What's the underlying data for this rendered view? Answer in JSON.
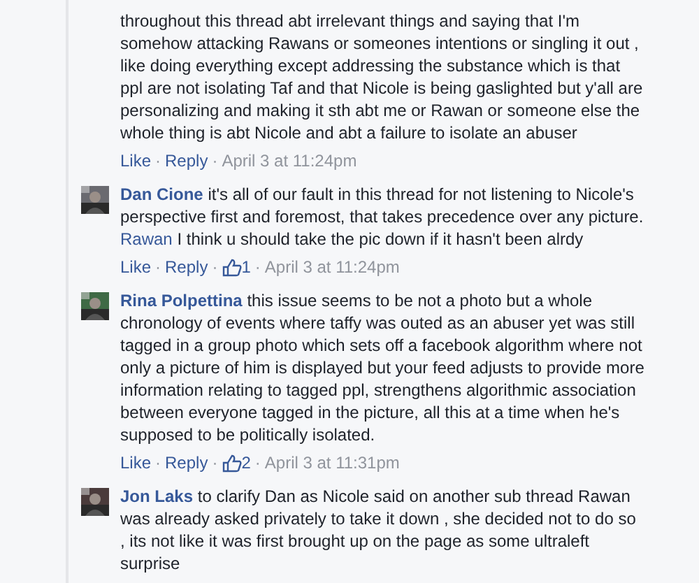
{
  "comments": [
    {
      "parts": [
        {
          "kind": "text",
          "text": "throughout this thread abt irrelevant things and saying that I'm somehow attacking Rawans or someones intentions or singling it out , like doing everything except addressing the substance which is that ppl are not isolating Taf and that Nicole is being gaslighted but y'all are personalizing and making it sth abt me or Rawan or someone else the whole thing is abt Nicole and abt a failure to isolate an abuser"
        }
      ],
      "actions": [
        {
          "kind": "link",
          "text": "Like"
        },
        {
          "kind": "sep",
          "text": "·"
        },
        {
          "kind": "link",
          "text": "Reply"
        },
        {
          "kind": "sep",
          "text": "·"
        },
        {
          "kind": "time",
          "text": "April 3 at 11:24pm"
        }
      ]
    },
    {
      "author": "Dan Cione",
      "parts": [
        {
          "kind": "text",
          "text": "it's all of our fault in this thread for not listening to Nicole's perspective first and foremost, that takes precedence over any picture. "
        },
        {
          "kind": "mention",
          "text": "Rawan"
        },
        {
          "kind": "text",
          "text": " I think u should take the pic down if it hasn't been alrdy"
        }
      ],
      "actions": [
        {
          "kind": "link",
          "text": "Like"
        },
        {
          "kind": "sep",
          "text": "·"
        },
        {
          "kind": "link",
          "text": "Reply"
        },
        {
          "kind": "sep",
          "text": "·"
        },
        {
          "kind": "likes",
          "text": "1"
        },
        {
          "kind": "sep",
          "text": "·"
        },
        {
          "kind": "time",
          "text": "April 3 at 11:24pm"
        }
      ]
    },
    {
      "author": "Rina Polpettina",
      "parts": [
        {
          "kind": "text",
          "text": "this issue seems to be not a photo but a whole chronology of events where taffy was outed as an abuser yet was still tagged in a group photo which sets off a facebook algorithm where not only a picture of him is displayed but your feed adjusts to provide more information relating to tagged ppl, strengthens algorithmic association between everyone tagged in the picture, all this at a time when he's supposed to be politically isolated."
        }
      ],
      "actions": [
        {
          "kind": "link",
          "text": "Like"
        },
        {
          "kind": "sep",
          "text": "·"
        },
        {
          "kind": "link",
          "text": "Reply"
        },
        {
          "kind": "sep",
          "text": "·"
        },
        {
          "kind": "likes",
          "text": "2"
        },
        {
          "kind": "sep",
          "text": "·"
        },
        {
          "kind": "time",
          "text": "April 3 at 11:31pm"
        }
      ]
    },
    {
      "author": "Jon Laks",
      "parts": [
        {
          "kind": "text",
          "text": "to clarify Dan as Nicole said on another sub thread Rawan was already asked privately to take it down , she decided not to do so , its not like it was first brought up on the page as some ultraleft surprise"
        }
      ]
    }
  ]
}
